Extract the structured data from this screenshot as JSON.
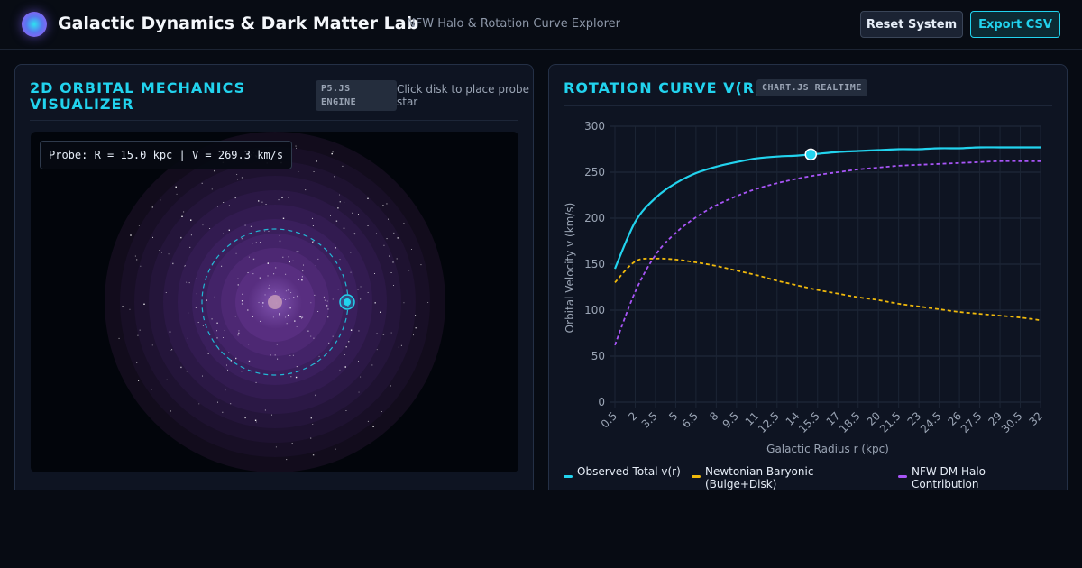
{
  "header": {
    "title": "Galactic Dynamics & Dark Matter Lab",
    "subtitle": "NFW Halo & Rotation Curve Explorer",
    "reset_label": "Reset System",
    "export_label": "Export CSV"
  },
  "orbital_panel": {
    "title": "2D ORBITAL MECHANICS VISUALIZER",
    "engine_tag": "P5.JS ENGINE",
    "hint": "Click disk to place probe star",
    "probe_readout": "Probe: R = 15.0 kpc | V = 269.3 km/s"
  },
  "curve_panel": {
    "title": "ROTATION CURVE V(R)",
    "engine_tag": "CHART.JS REALTIME"
  },
  "colors": {
    "accent": "#22d3ee",
    "observed": "#22d3ee",
    "baryonic": "#f0b90b",
    "dm_halo": "#a855f7"
  },
  "chart_data": {
    "type": "line",
    "xlabel": "Galactic Radius r (kpc)",
    "ylabel": "Orbital Velocity v (km/s)",
    "ylim": [
      0,
      300
    ],
    "yticks": [
      0,
      50,
      100,
      150,
      200,
      250,
      300
    ],
    "categories": [
      "0.5",
      "2",
      "3.5",
      "5",
      "6.5",
      "8",
      "9.5",
      "11",
      "12.5",
      "14",
      "15.5",
      "17",
      "18.5",
      "20",
      "21.5",
      "23",
      "24.5",
      "26",
      "27.5",
      "29",
      "30.5",
      "32"
    ],
    "x": [
      0.5,
      2,
      3.5,
      5,
      6.5,
      8,
      9.5,
      11,
      12.5,
      14,
      15.5,
      17,
      18.5,
      20,
      21.5,
      23,
      24.5,
      26,
      27.5,
      29,
      30.5,
      32
    ],
    "series": [
      {
        "name": "Observed Total v(r)",
        "color": "#22d3ee",
        "dash": false,
        "values": [
          145,
          196,
          222,
          238,
          249,
          256,
          261,
          265,
          267,
          268,
          270,
          272,
          273,
          274,
          275,
          275,
          276,
          276,
          277,
          277,
          277,
          277
        ]
      },
      {
        "name": "Newtonian Baryonic (Bulge+Disk)",
        "color": "#f0b90b",
        "dash": true,
        "values": [
          130,
          153,
          156,
          155,
          152,
          148,
          143,
          138,
          132,
          127,
          122,
          118,
          114,
          111,
          107,
          104,
          101,
          98,
          96,
          94,
          92,
          89
        ]
      },
      {
        "name": "NFW DM Halo Contribution",
        "color": "#a855f7",
        "dash": true,
        "values": [
          62,
          120,
          160,
          184,
          201,
          214,
          224,
          232,
          238,
          243,
          247,
          250,
          253,
          255,
          257,
          258,
          259,
          260,
          261,
          262,
          262,
          262
        ]
      }
    ],
    "highlight": {
      "x": 15,
      "y": 269.3
    },
    "grid": true,
    "legend_position": "bottom"
  }
}
